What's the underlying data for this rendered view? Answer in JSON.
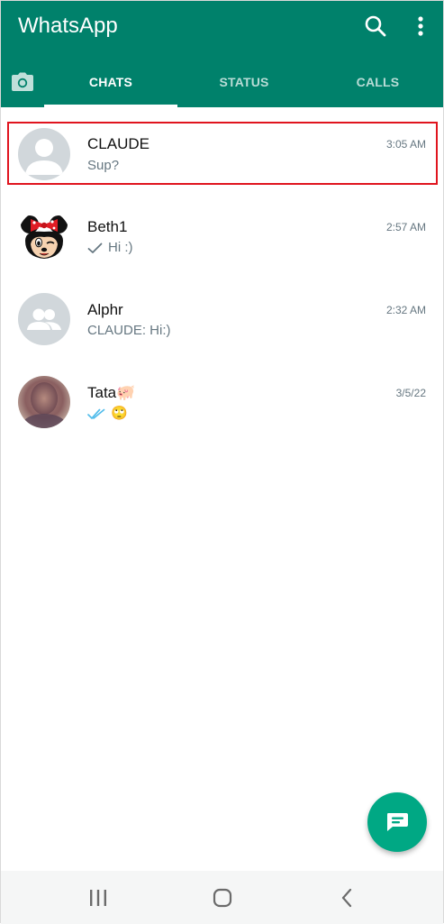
{
  "app": {
    "title": "WhatsApp"
  },
  "header": {
    "search_icon": "search-icon",
    "menu_icon": "more-vertical-icon"
  },
  "tabs": [
    {
      "label": "CHATS",
      "active": true
    },
    {
      "label": "STATUS",
      "active": false
    },
    {
      "label": "CALLS",
      "active": false
    }
  ],
  "chats": [
    {
      "name": "CLAUDE",
      "preview": "Sup?",
      "time": "3:05 AM",
      "avatar": "default-person-avatar",
      "highlighted": true
    },
    {
      "name": "Beth1",
      "preview": "Hi :)",
      "time": "2:57 AM",
      "avatar": "cartoon-mouse-avatar",
      "status_icon": "single-check-icon"
    },
    {
      "name": "Alphr",
      "preview": "CLAUDE: Hi:)",
      "time": "2:32 AM",
      "avatar": "group-avatar"
    },
    {
      "name": "Tata🐖",
      "preview": "🙄",
      "time": "3/5/22",
      "avatar": "blurred-photo-avatar",
      "status_icon": "double-check-blue-icon"
    }
  ],
  "colors": {
    "header": "#00816b",
    "fab": "#00a884",
    "highlight_border": "#e0141e",
    "read_receipt": "#53bdeb"
  },
  "fab": {
    "icon": "new-chat-icon"
  },
  "system_nav": {
    "recent_icon": "recent-apps-icon",
    "home_icon": "home-icon",
    "back_icon": "back-icon"
  }
}
